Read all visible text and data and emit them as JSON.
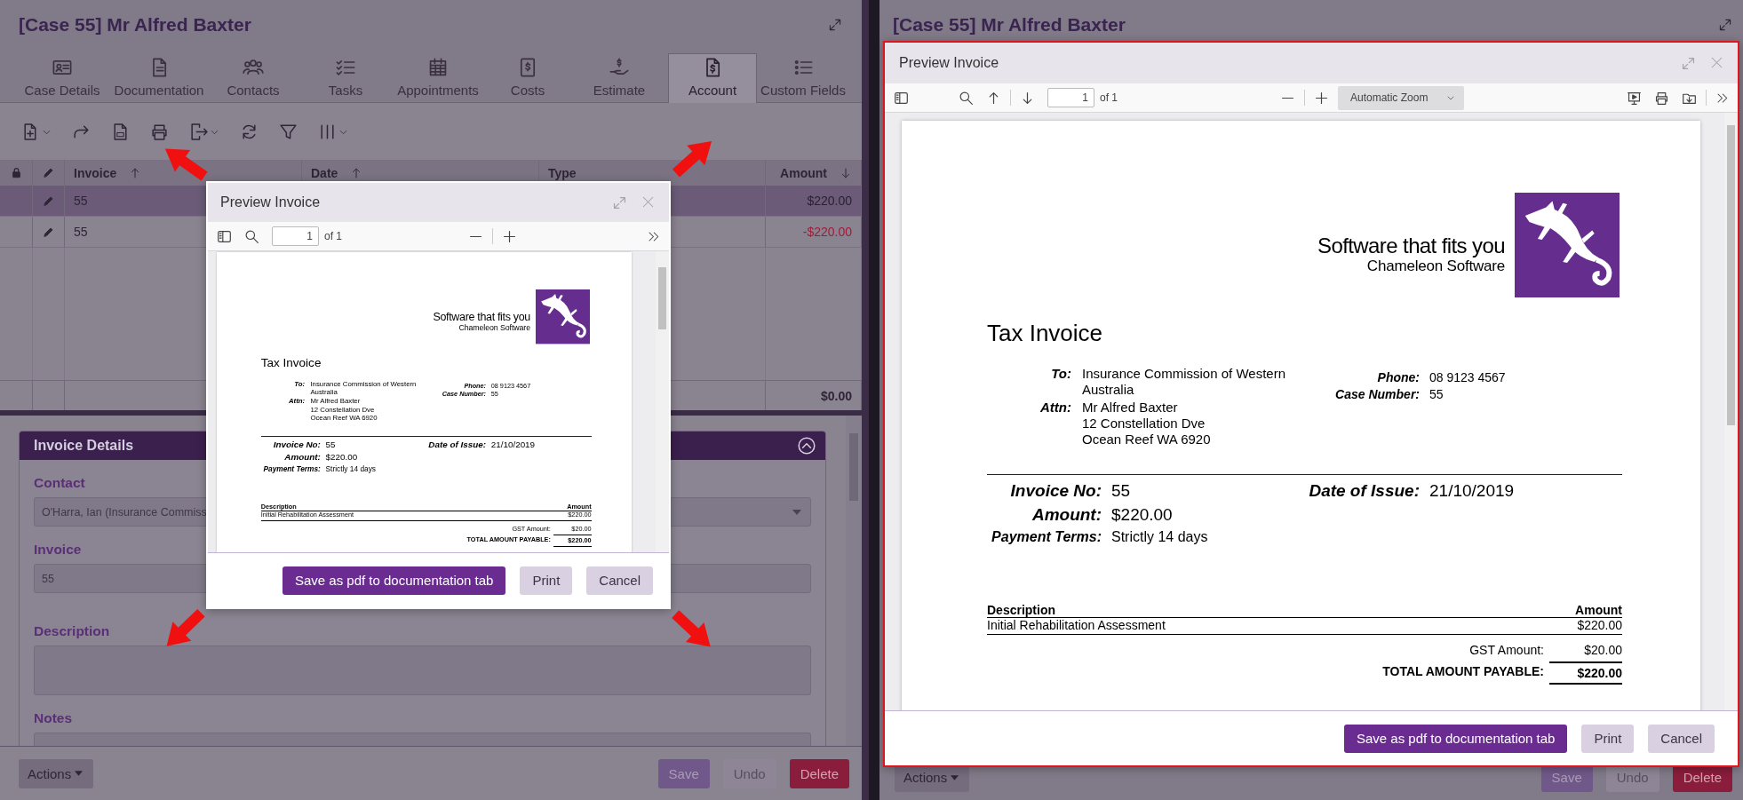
{
  "left_panel": {
    "title": "[Case 55] Mr Alfred Baxter",
    "tabs": [
      {
        "label": "Case Details",
        "selected": false
      },
      {
        "label": "Documentation",
        "selected": false
      },
      {
        "label": "Contacts",
        "selected": false
      },
      {
        "label": "Tasks",
        "selected": false
      },
      {
        "label": "Appointments",
        "selected": false
      },
      {
        "label": "Costs",
        "selected": false
      },
      {
        "label": "Estimate",
        "selected": false
      },
      {
        "label": "Account",
        "selected": true
      },
      {
        "label": "Custom Fields",
        "selected": false
      }
    ],
    "table": {
      "columns": [
        {
          "label": "Invoice",
          "sorted": true,
          "descending": false
        },
        {
          "label": "Date",
          "sorted": true,
          "descending": false
        },
        {
          "label": "Type",
          "sorted": false
        },
        {
          "label": "Amount",
          "sorted": true,
          "descending": true
        }
      ],
      "rows": [
        {
          "invoice": "55",
          "amount": "$220.00",
          "selected": true,
          "negative": false
        },
        {
          "invoice": "55",
          "amount": "-$220.00",
          "selected": false,
          "negative": true
        }
      ],
      "total": "$0.00"
    },
    "invoice_details": {
      "title": "Invoice Details",
      "expanded": true,
      "fields": [
        {
          "label": "Contact",
          "value": "O'Harra, Ian (Insurance Commiss",
          "kind": "select"
        },
        {
          "label": "Invoice",
          "value": "55",
          "kind": "text"
        },
        {
          "label": "Description",
          "kind": "textarea"
        },
        {
          "label": "Notes",
          "kind": "text"
        }
      ]
    },
    "footer": {
      "actions": "Actions",
      "buttons": [
        {
          "label": "Save",
          "kind": "save",
          "disabled": false
        },
        {
          "label": "Undo",
          "kind": "undo",
          "disabled": true
        },
        {
          "label": "Delete",
          "kind": "delete",
          "disabled": false
        }
      ]
    }
  },
  "left_preview": {
    "title": "Preview Invoice",
    "kind": "compact",
    "highlighted": false,
    "page": "1",
    "page_count": "of 1",
    "invoice": {
      "brand": "Software that fits you",
      "company": "Chameleon Software",
      "heading": "Tax Invoice",
      "to_label": "To:",
      "to": "Insurance Commission of Western Australia",
      "attn_label": "Attn:",
      "attn": [
        "Mr Alfred Baxter",
        "12 Constellation Dve",
        "Ocean Reef WA 6920"
      ],
      "contact": [
        {
          "label": "Phone:",
          "value": "08 9123 4567"
        },
        {
          "label": "Case Number:",
          "value": "55"
        }
      ],
      "summary": [
        {
          "label": "Invoice No:",
          "value": "55",
          "kind": "large"
        },
        {
          "label": "Amount:",
          "value": "$220.00",
          "kind": "large"
        },
        {
          "label": "Payment Terms:",
          "value": "Strictly 14 days",
          "kind": "small"
        }
      ],
      "date_label": "Date of Issue:",
      "date": "21/10/2019",
      "items_header": [
        "Description",
        "Amount"
      ],
      "items": [
        {
          "description": "Initial Rehabilitation Assessment",
          "amount": "$220.00"
        }
      ],
      "gst_label": "GST Amount:",
      "gst": "$20.00",
      "total_label": "TOTAL AMOUNT PAYABLE:",
      "total": "$220.00"
    },
    "buttons": [
      {
        "label": "Save as pdf to documentation tab",
        "kind": "primary"
      },
      {
        "label": "Print",
        "kind": "secondary"
      },
      {
        "label": "Cancel",
        "kind": "secondary"
      }
    ]
  },
  "right_panel": {
    "title": "[Case 55] Mr Alfred Baxter",
    "footer": {
      "actions": "Actions",
      "buttons": [
        {
          "label": "Save",
          "kind": "save",
          "disabled": false
        },
        {
          "label": "Undo",
          "kind": "undo",
          "disabled": true
        },
        {
          "label": "Delete",
          "kind": "delete",
          "disabled": false
        }
      ]
    }
  },
  "right_preview": {
    "title": "Preview Invoice",
    "kind": "full",
    "highlighted": true,
    "page": "1",
    "page_count": "of 1",
    "zoom": "Automatic Zoom",
    "invoice": {
      "brand": "Software that fits you",
      "company": "Chameleon Software",
      "heading": "Tax Invoice",
      "to_label": "To:",
      "to": "Insurance Commission of Western Australia",
      "attn_label": "Attn:",
      "attn": [
        "Mr Alfred Baxter",
        "12 Constellation Dve",
        "Ocean Reef WA 6920"
      ],
      "contact": [
        {
          "label": "Phone:",
          "value": "08 9123 4567"
        },
        {
          "label": "Case Number:",
          "value": "55"
        }
      ],
      "summary": [
        {
          "label": "Invoice No:",
          "value": "55",
          "kind": "large"
        },
        {
          "label": "Amount:",
          "value": "$220.00",
          "kind": "large"
        },
        {
          "label": "Payment Terms:",
          "value": "Strictly 14 days",
          "kind": "small"
        }
      ],
      "date_label": "Date of Issue:",
      "date": "21/10/2019",
      "items_header": [
        "Description",
        "Amount"
      ],
      "items": [
        {
          "description": "Initial Rehabilitation Assessment",
          "amount": "$220.00"
        }
      ],
      "gst_label": "GST Amount:",
      "gst": "$20.00",
      "total_label": "TOTAL AMOUNT PAYABLE:",
      "total": "$220.00"
    },
    "buttons": [
      {
        "label": "Save as pdf to documentation tab",
        "kind": "primary"
      },
      {
        "label": "Print",
        "kind": "secondary"
      },
      {
        "label": "Cancel",
        "kind": "secondary"
      }
    ]
  }
}
